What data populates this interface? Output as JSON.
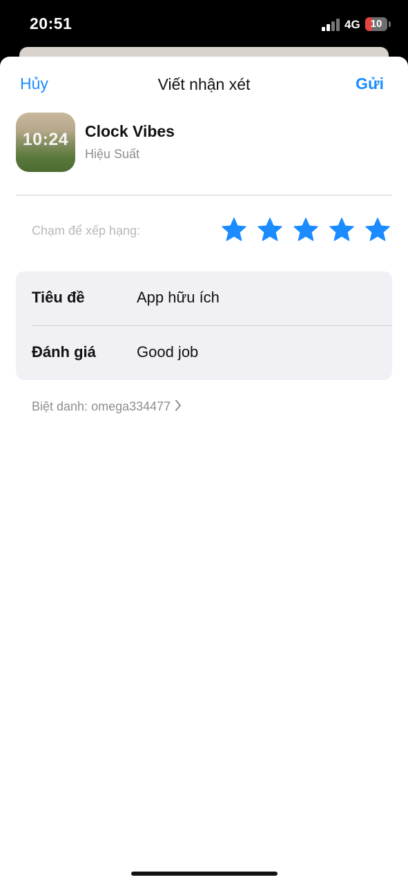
{
  "status_bar": {
    "time": "20:51",
    "network": "4G",
    "battery": "10",
    "icons": [
      "signal-icon",
      "battery-icon"
    ]
  },
  "colors": {
    "accent": "#1a8cff",
    "star": "#1a8cff",
    "card_bg": "#f0f0f5",
    "battery_low": "#e5433d"
  },
  "nav": {
    "cancel_label": "Hủy",
    "title": "Viết nhận xét",
    "send_label": "Gửi"
  },
  "app": {
    "icon_time": "10:24",
    "name": "Clock Vibes",
    "category": "Hiệu Suất"
  },
  "rating": {
    "prompt": "Chạm để xếp hạng:",
    "value": 5,
    "max": 5
  },
  "form": {
    "title_label": "Tiêu đề",
    "title_value": "App hữu ích",
    "review_label": "Đánh giá",
    "review_value": "Good job"
  },
  "nickname": {
    "text": "Biệt danh: omega334477",
    "icon": "chevron-right-icon"
  }
}
